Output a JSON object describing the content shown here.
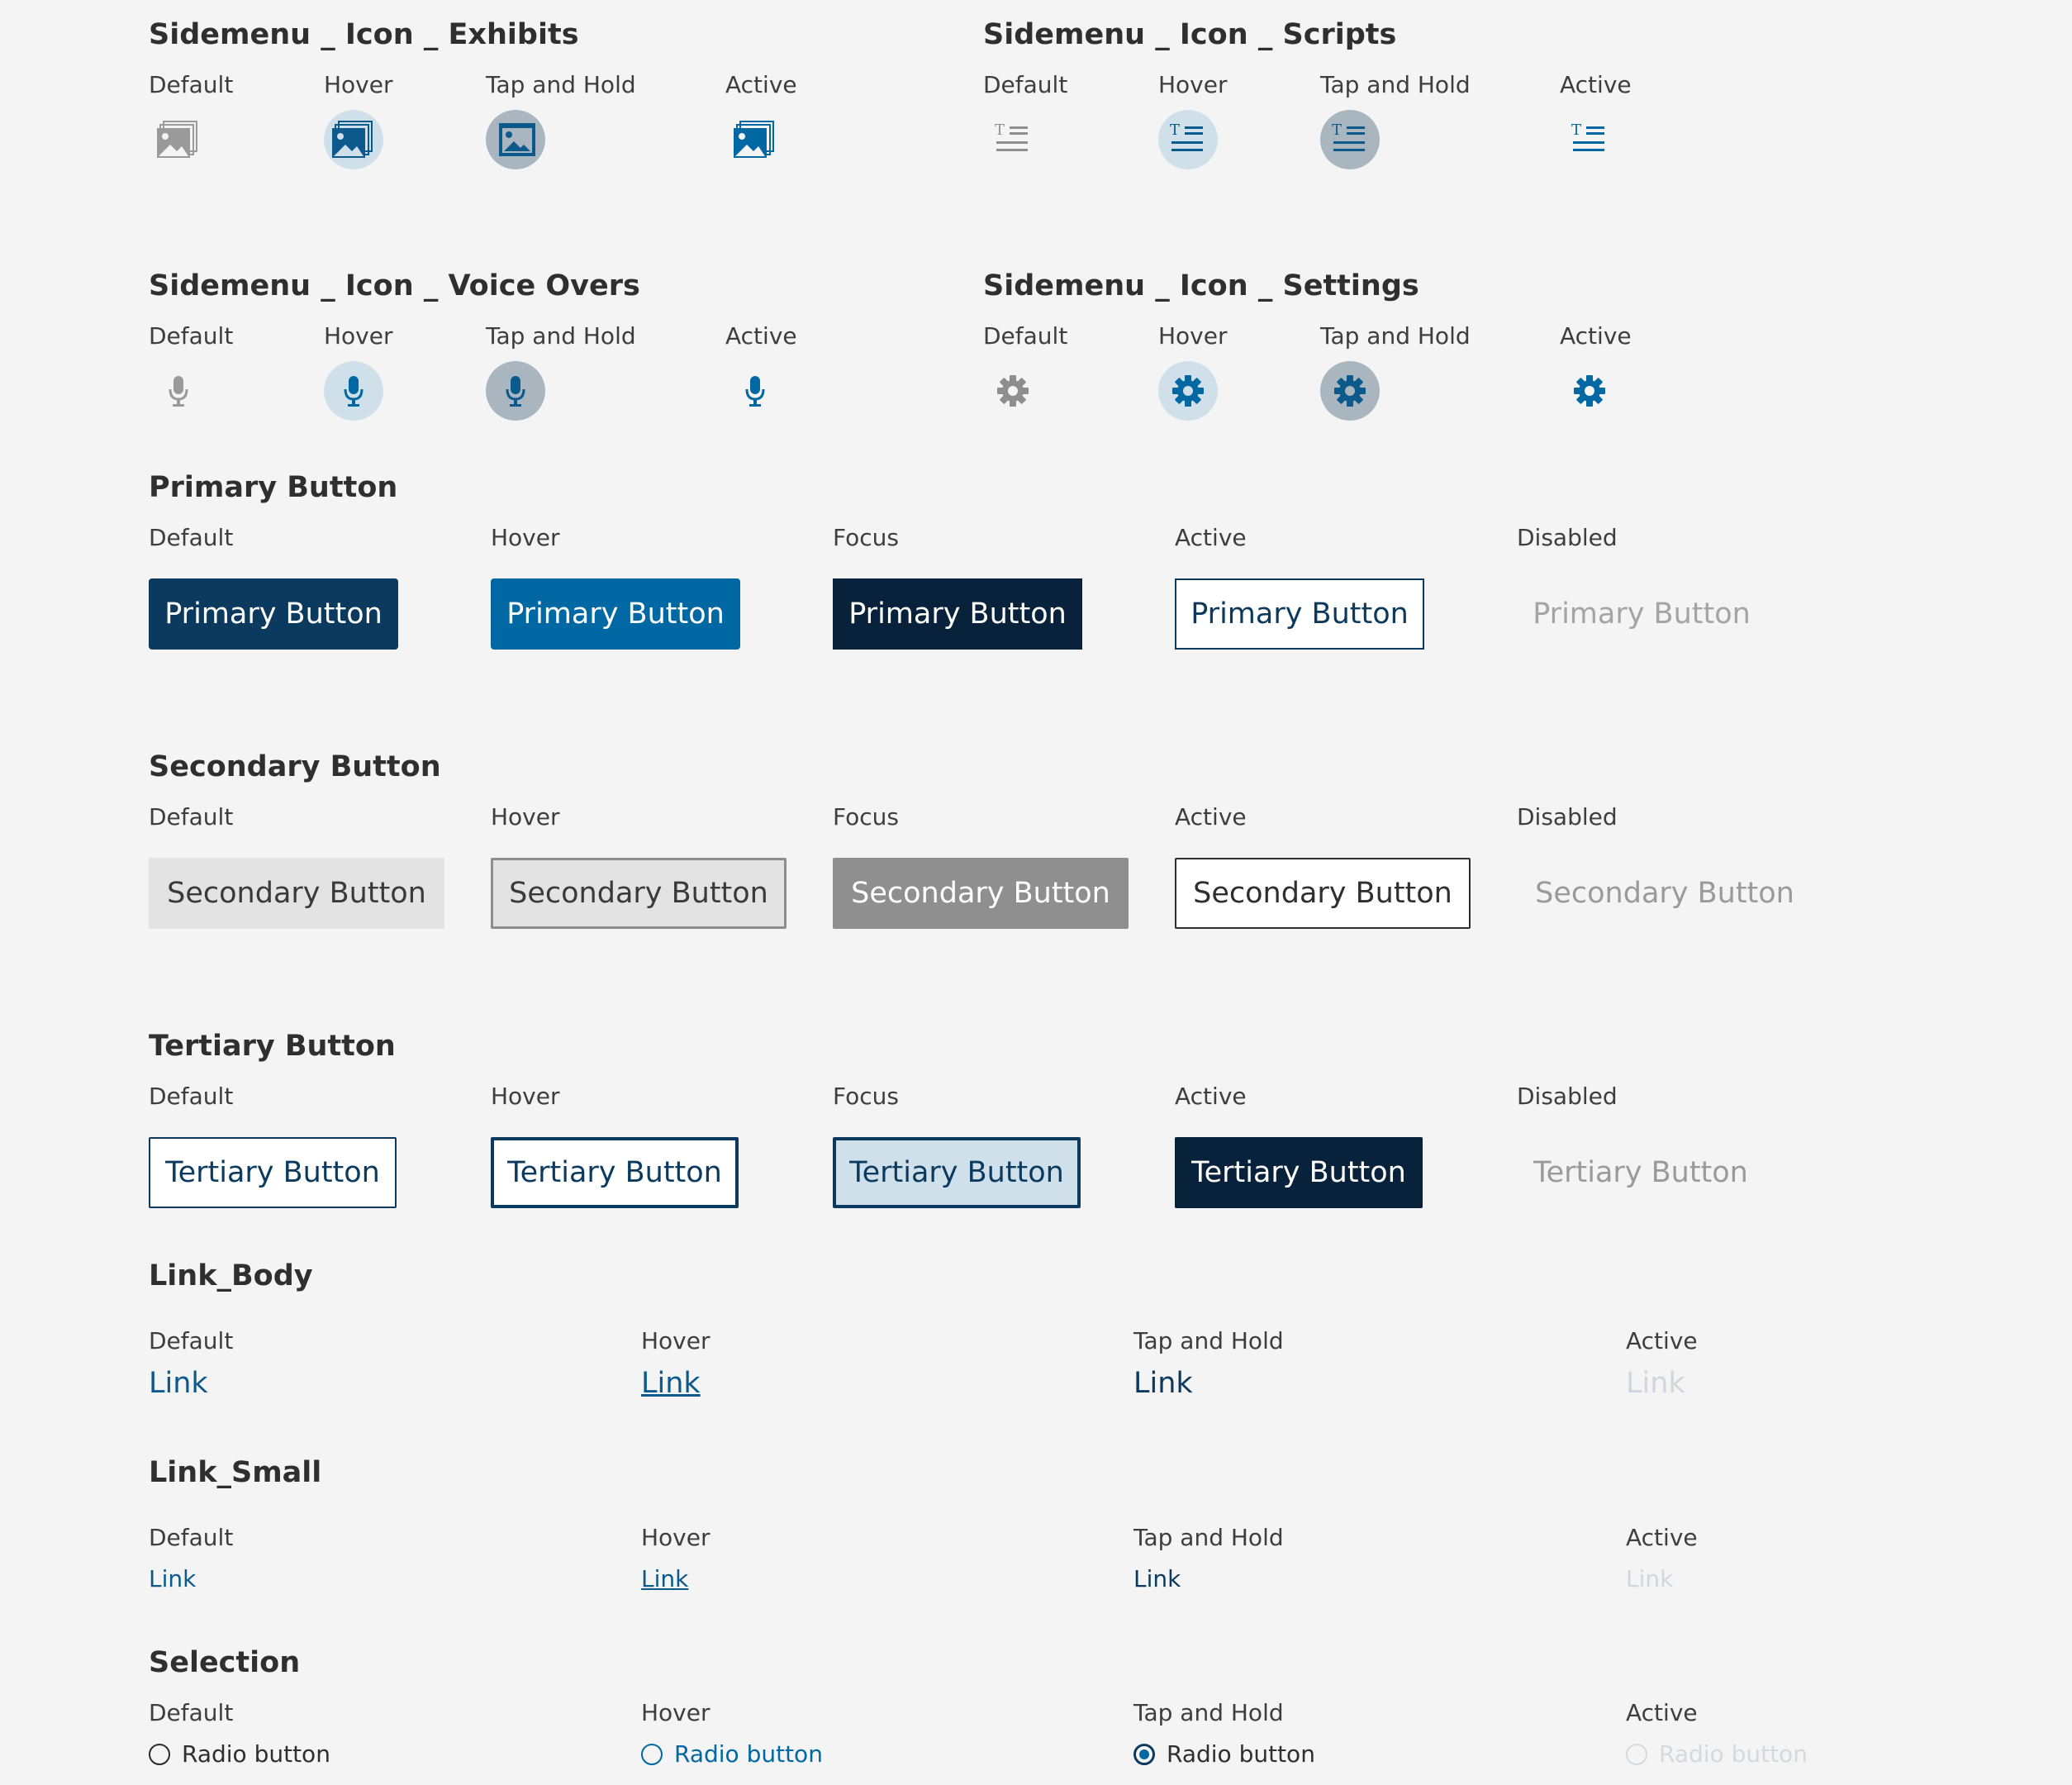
{
  "sections": {
    "exhibits": {
      "title": "Sidemenu _ Icon _ Exhibits",
      "icon": "image-stack-icon"
    },
    "scripts": {
      "title": "Sidemenu _ Icon _ Scripts",
      "icon": "text-lines-icon"
    },
    "voice": {
      "title": "Sidemenu _ Icon _ Voice Overs",
      "icon": "microphone-icon"
    },
    "settings": {
      "title": "Sidemenu _ Icon _ Settings",
      "icon": "gear-icon"
    },
    "primary": {
      "title": "Primary Button"
    },
    "secondary": {
      "title": "Secondary Button"
    },
    "tertiary": {
      "title": "Tertiary Button"
    },
    "link_body": {
      "title": "Link_Body"
    },
    "link_small": {
      "title": "Link_Small"
    },
    "selection": {
      "title": "Selection"
    }
  },
  "states": {
    "default": "Default",
    "hover": "Hover",
    "tap_hold": "Tap and Hold",
    "active": "Active",
    "focus": "Focus",
    "disabled": "Disabled"
  },
  "labels": {
    "primary_button": "Primary Button",
    "secondary_button": "Secondary Button",
    "tertiary_button": "Tertiary Button",
    "link": "Link",
    "radio_button": "Radio button"
  },
  "colors": {
    "background": "#f4f4f4",
    "brand_dark": "#0c3a5e",
    "brand_hover": "#0268a3",
    "brand_focus": "#07223a",
    "icon_default": "#8e8e8e",
    "icon_active": "#0268a3",
    "hover_circle": "#cfe0ea",
    "hold_circle": "#a9b6c0",
    "secondary_bg": "#e3e3e3",
    "secondary_focus": "#8f8f8f",
    "disabled_text": "#a4a4a4"
  }
}
